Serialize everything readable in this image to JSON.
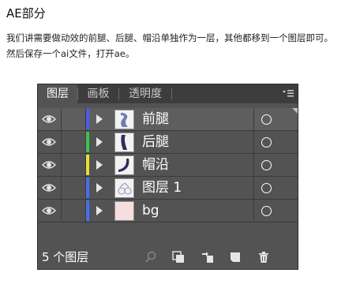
{
  "article": {
    "heading": "AE部分",
    "paragraph": "我们讲需要做动效的前腿、后腿、帽沿单独作为一层，其他都移到一个图层即可。然后保存一个ai文件，打开ae。"
  },
  "panel": {
    "tabs": [
      {
        "label": "图层",
        "active": true
      },
      {
        "label": "画板",
        "active": false
      },
      {
        "label": "透明度",
        "active": false
      }
    ],
    "menu_icon": "panel-menu-icon",
    "layers": [
      {
        "name": "前腿",
        "color": "#4a5cf0",
        "selected": true
      },
      {
        "name": "后腿",
        "color": "#3ec54a",
        "selected": false
      },
      {
        "name": "帽沿",
        "color": "#e8df3a",
        "selected": false
      },
      {
        "name": "图层 1",
        "color": "#4a6ef0",
        "selected": false
      },
      {
        "name": "bg",
        "color": "#4a6ef0",
        "selected": false
      }
    ],
    "footer": {
      "count_label": "5 个图层",
      "icons": [
        "search-icon",
        "make-clipping-mask-icon",
        "create-sublayer-icon",
        "new-layer-icon",
        "delete-icon"
      ]
    }
  }
}
